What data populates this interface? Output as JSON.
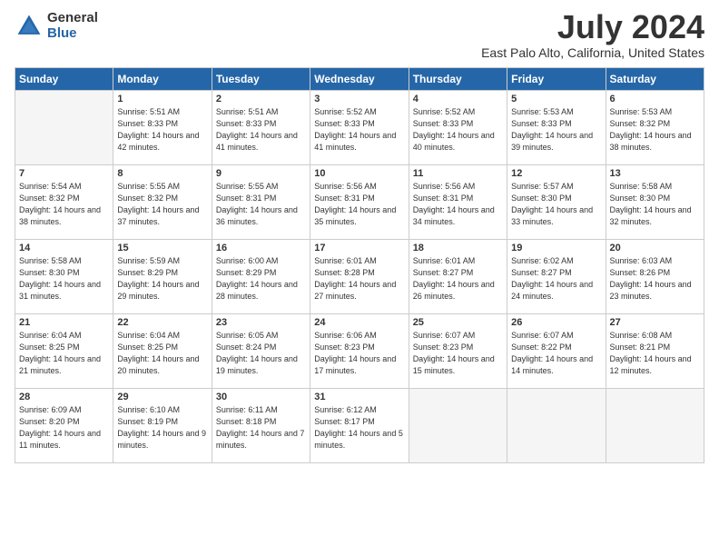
{
  "logo": {
    "general": "General",
    "blue": "Blue"
  },
  "title": "July 2024",
  "location": "East Palo Alto, California, United States",
  "headers": [
    "Sunday",
    "Monday",
    "Tuesday",
    "Wednesday",
    "Thursday",
    "Friday",
    "Saturday"
  ],
  "weeks": [
    [
      {
        "num": "",
        "empty": true
      },
      {
        "num": "1",
        "sunrise": "Sunrise: 5:51 AM",
        "sunset": "Sunset: 8:33 PM",
        "daylight": "Daylight: 14 hours and 42 minutes."
      },
      {
        "num": "2",
        "sunrise": "Sunrise: 5:51 AM",
        "sunset": "Sunset: 8:33 PM",
        "daylight": "Daylight: 14 hours and 41 minutes."
      },
      {
        "num": "3",
        "sunrise": "Sunrise: 5:52 AM",
        "sunset": "Sunset: 8:33 PM",
        "daylight": "Daylight: 14 hours and 41 minutes."
      },
      {
        "num": "4",
        "sunrise": "Sunrise: 5:52 AM",
        "sunset": "Sunset: 8:33 PM",
        "daylight": "Daylight: 14 hours and 40 minutes."
      },
      {
        "num": "5",
        "sunrise": "Sunrise: 5:53 AM",
        "sunset": "Sunset: 8:33 PM",
        "daylight": "Daylight: 14 hours and 39 minutes."
      },
      {
        "num": "6",
        "sunrise": "Sunrise: 5:53 AM",
        "sunset": "Sunset: 8:32 PM",
        "daylight": "Daylight: 14 hours and 38 minutes."
      }
    ],
    [
      {
        "num": "7",
        "sunrise": "Sunrise: 5:54 AM",
        "sunset": "Sunset: 8:32 PM",
        "daylight": "Daylight: 14 hours and 38 minutes."
      },
      {
        "num": "8",
        "sunrise": "Sunrise: 5:55 AM",
        "sunset": "Sunset: 8:32 PM",
        "daylight": "Daylight: 14 hours and 37 minutes."
      },
      {
        "num": "9",
        "sunrise": "Sunrise: 5:55 AM",
        "sunset": "Sunset: 8:31 PM",
        "daylight": "Daylight: 14 hours and 36 minutes."
      },
      {
        "num": "10",
        "sunrise": "Sunrise: 5:56 AM",
        "sunset": "Sunset: 8:31 PM",
        "daylight": "Daylight: 14 hours and 35 minutes."
      },
      {
        "num": "11",
        "sunrise": "Sunrise: 5:56 AM",
        "sunset": "Sunset: 8:31 PM",
        "daylight": "Daylight: 14 hours and 34 minutes."
      },
      {
        "num": "12",
        "sunrise": "Sunrise: 5:57 AM",
        "sunset": "Sunset: 8:30 PM",
        "daylight": "Daylight: 14 hours and 33 minutes."
      },
      {
        "num": "13",
        "sunrise": "Sunrise: 5:58 AM",
        "sunset": "Sunset: 8:30 PM",
        "daylight": "Daylight: 14 hours and 32 minutes."
      }
    ],
    [
      {
        "num": "14",
        "sunrise": "Sunrise: 5:58 AM",
        "sunset": "Sunset: 8:30 PM",
        "daylight": "Daylight: 14 hours and 31 minutes."
      },
      {
        "num": "15",
        "sunrise": "Sunrise: 5:59 AM",
        "sunset": "Sunset: 8:29 PM",
        "daylight": "Daylight: 14 hours and 29 minutes."
      },
      {
        "num": "16",
        "sunrise": "Sunrise: 6:00 AM",
        "sunset": "Sunset: 8:29 PM",
        "daylight": "Daylight: 14 hours and 28 minutes."
      },
      {
        "num": "17",
        "sunrise": "Sunrise: 6:01 AM",
        "sunset": "Sunset: 8:28 PM",
        "daylight": "Daylight: 14 hours and 27 minutes."
      },
      {
        "num": "18",
        "sunrise": "Sunrise: 6:01 AM",
        "sunset": "Sunset: 8:27 PM",
        "daylight": "Daylight: 14 hours and 26 minutes."
      },
      {
        "num": "19",
        "sunrise": "Sunrise: 6:02 AM",
        "sunset": "Sunset: 8:27 PM",
        "daylight": "Daylight: 14 hours and 24 minutes."
      },
      {
        "num": "20",
        "sunrise": "Sunrise: 6:03 AM",
        "sunset": "Sunset: 8:26 PM",
        "daylight": "Daylight: 14 hours and 23 minutes."
      }
    ],
    [
      {
        "num": "21",
        "sunrise": "Sunrise: 6:04 AM",
        "sunset": "Sunset: 8:25 PM",
        "daylight": "Daylight: 14 hours and 21 minutes."
      },
      {
        "num": "22",
        "sunrise": "Sunrise: 6:04 AM",
        "sunset": "Sunset: 8:25 PM",
        "daylight": "Daylight: 14 hours and 20 minutes."
      },
      {
        "num": "23",
        "sunrise": "Sunrise: 6:05 AM",
        "sunset": "Sunset: 8:24 PM",
        "daylight": "Daylight: 14 hours and 19 minutes."
      },
      {
        "num": "24",
        "sunrise": "Sunrise: 6:06 AM",
        "sunset": "Sunset: 8:23 PM",
        "daylight": "Daylight: 14 hours and 17 minutes."
      },
      {
        "num": "25",
        "sunrise": "Sunrise: 6:07 AM",
        "sunset": "Sunset: 8:23 PM",
        "daylight": "Daylight: 14 hours and 15 minutes."
      },
      {
        "num": "26",
        "sunrise": "Sunrise: 6:07 AM",
        "sunset": "Sunset: 8:22 PM",
        "daylight": "Daylight: 14 hours and 14 minutes."
      },
      {
        "num": "27",
        "sunrise": "Sunrise: 6:08 AM",
        "sunset": "Sunset: 8:21 PM",
        "daylight": "Daylight: 14 hours and 12 minutes."
      }
    ],
    [
      {
        "num": "28",
        "sunrise": "Sunrise: 6:09 AM",
        "sunset": "Sunset: 8:20 PM",
        "daylight": "Daylight: 14 hours and 11 minutes."
      },
      {
        "num": "29",
        "sunrise": "Sunrise: 6:10 AM",
        "sunset": "Sunset: 8:19 PM",
        "daylight": "Daylight: 14 hours and 9 minutes."
      },
      {
        "num": "30",
        "sunrise": "Sunrise: 6:11 AM",
        "sunset": "Sunset: 8:18 PM",
        "daylight": "Daylight: 14 hours and 7 minutes."
      },
      {
        "num": "31",
        "sunrise": "Sunrise: 6:12 AM",
        "sunset": "Sunset: 8:17 PM",
        "daylight": "Daylight: 14 hours and 5 minutes."
      },
      {
        "num": "",
        "empty": true
      },
      {
        "num": "",
        "empty": true
      },
      {
        "num": "",
        "empty": true
      }
    ]
  ]
}
